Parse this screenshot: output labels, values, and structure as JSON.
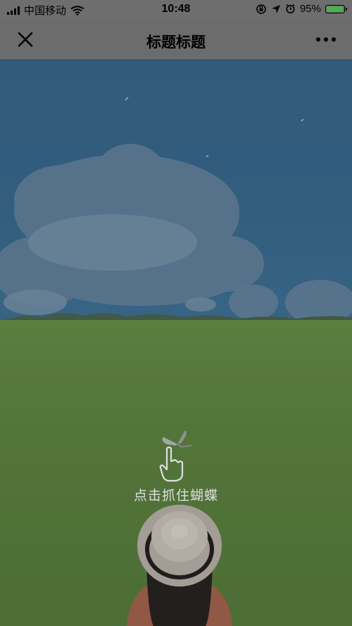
{
  "status_bar": {
    "carrier": "中国移动",
    "time": "10:48",
    "battery": "95%",
    "battery_level": 0.95
  },
  "nav": {
    "title": "标题标题"
  },
  "game": {
    "hint": "点击抓住蝴蝶"
  },
  "icons": {
    "close": "close-icon",
    "more": "more-dots-icon",
    "hand": "hand-pointer-icon",
    "butterfly": "butterfly-icon"
  },
  "colors": {
    "battery_fill": "#4caf50",
    "sky": "#2e6289",
    "grass": "#557f36"
  }
}
